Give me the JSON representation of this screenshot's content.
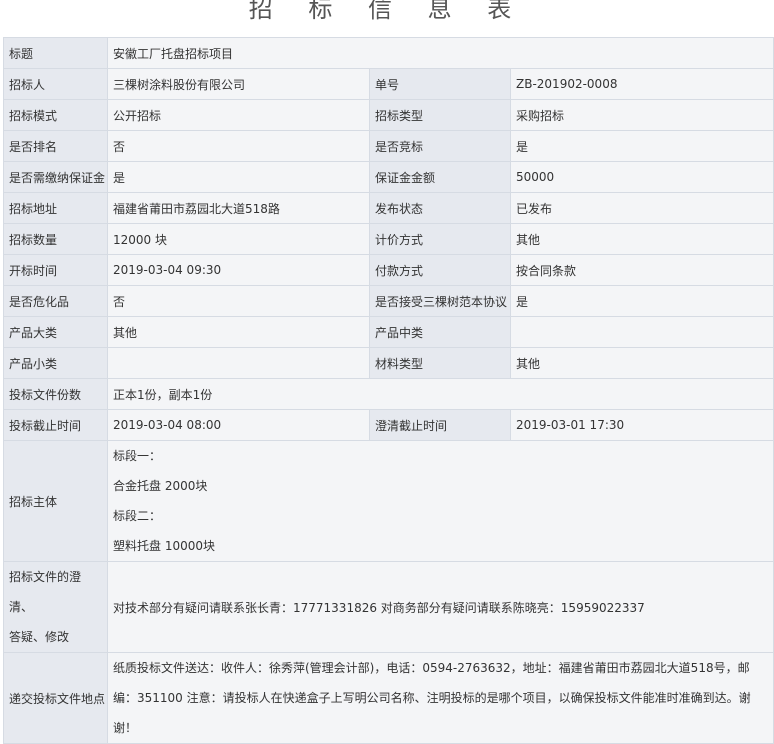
{
  "page_title": "招 标 信 息 表",
  "rows": {
    "title": {
      "label": "标题",
      "value": "安徽工厂托盘招标项目"
    },
    "tenderer": {
      "label": "招标人",
      "value": "三棵树涂料股份有限公司"
    },
    "order_no": {
      "label": "单号",
      "value": "ZB-201902-0008"
    },
    "mode": {
      "label": "招标模式",
      "value": "公开招标"
    },
    "type": {
      "label": "招标类型",
      "value": "采购招标"
    },
    "ranked": {
      "label": "是否排名",
      "value": "否"
    },
    "bidding": {
      "label": "是否竞标",
      "value": "是"
    },
    "deposit_required": {
      "label": "是否需缴纳保证金",
      "value": "是"
    },
    "deposit_amount": {
      "label": "保证金金额",
      "value": "50000"
    },
    "address": {
      "label": "招标地址",
      "value": "福建省莆田市荔园北大道518路"
    },
    "status": {
      "label": "发布状态",
      "value": "已发布"
    },
    "quantity": {
      "label": "招标数量",
      "value": "12000 块"
    },
    "pricing": {
      "label": "计价方式",
      "value": "其他"
    },
    "open_time": {
      "label": "开标时间",
      "value": "2019-03-04 09:30"
    },
    "payment": {
      "label": "付款方式",
      "value": "按合同条款"
    },
    "hazardous": {
      "label": "是否危化品",
      "value": "否"
    },
    "accept_template": {
      "label": "是否接受三棵树范本协议",
      "value": "是"
    },
    "category_major": {
      "label": "产品大类",
      "value": "其他"
    },
    "category_mid": {
      "label": "产品中类",
      "value": ""
    },
    "category_minor": {
      "label": "产品小类",
      "value": ""
    },
    "material_type": {
      "label": "材料类型",
      "value": "其他"
    },
    "copies": {
      "label": "投标文件份数",
      "value": "正本1份，副本1份"
    },
    "deadline": {
      "label": "投标截止时间",
      "value": "2019-03-04 08:00"
    },
    "clarify_deadline": {
      "label": "澄清截止时间",
      "value": "2019-03-01 17:30"
    },
    "subject": {
      "label": "招标主体",
      "lines": [
        "标段一：",
        "合金托盘  2000块",
        "标段二：",
        "塑料托盘  10000块"
      ]
    },
    "clarification": {
      "label_line1": "招标文件的澄清、",
      "label_line2": "答疑、修改",
      "value": "对技术部分有疑问请联系张长青：17771331826 对商务部分有疑问请联系陈晓亮：15959022337"
    },
    "delivery": {
      "label": "递交投标文件地点",
      "value": "纸质投标文件送达：收件人：徐秀萍(管理会计部)，电话：0594-2763632，地址：福建省莆田市荔园北大道518号，邮编：351100 注意：请投标人在快递盒子上写明公司名称、注明投标的是哪个项目，以确保投标文件能准时准确到达。谢谢！"
    }
  }
}
